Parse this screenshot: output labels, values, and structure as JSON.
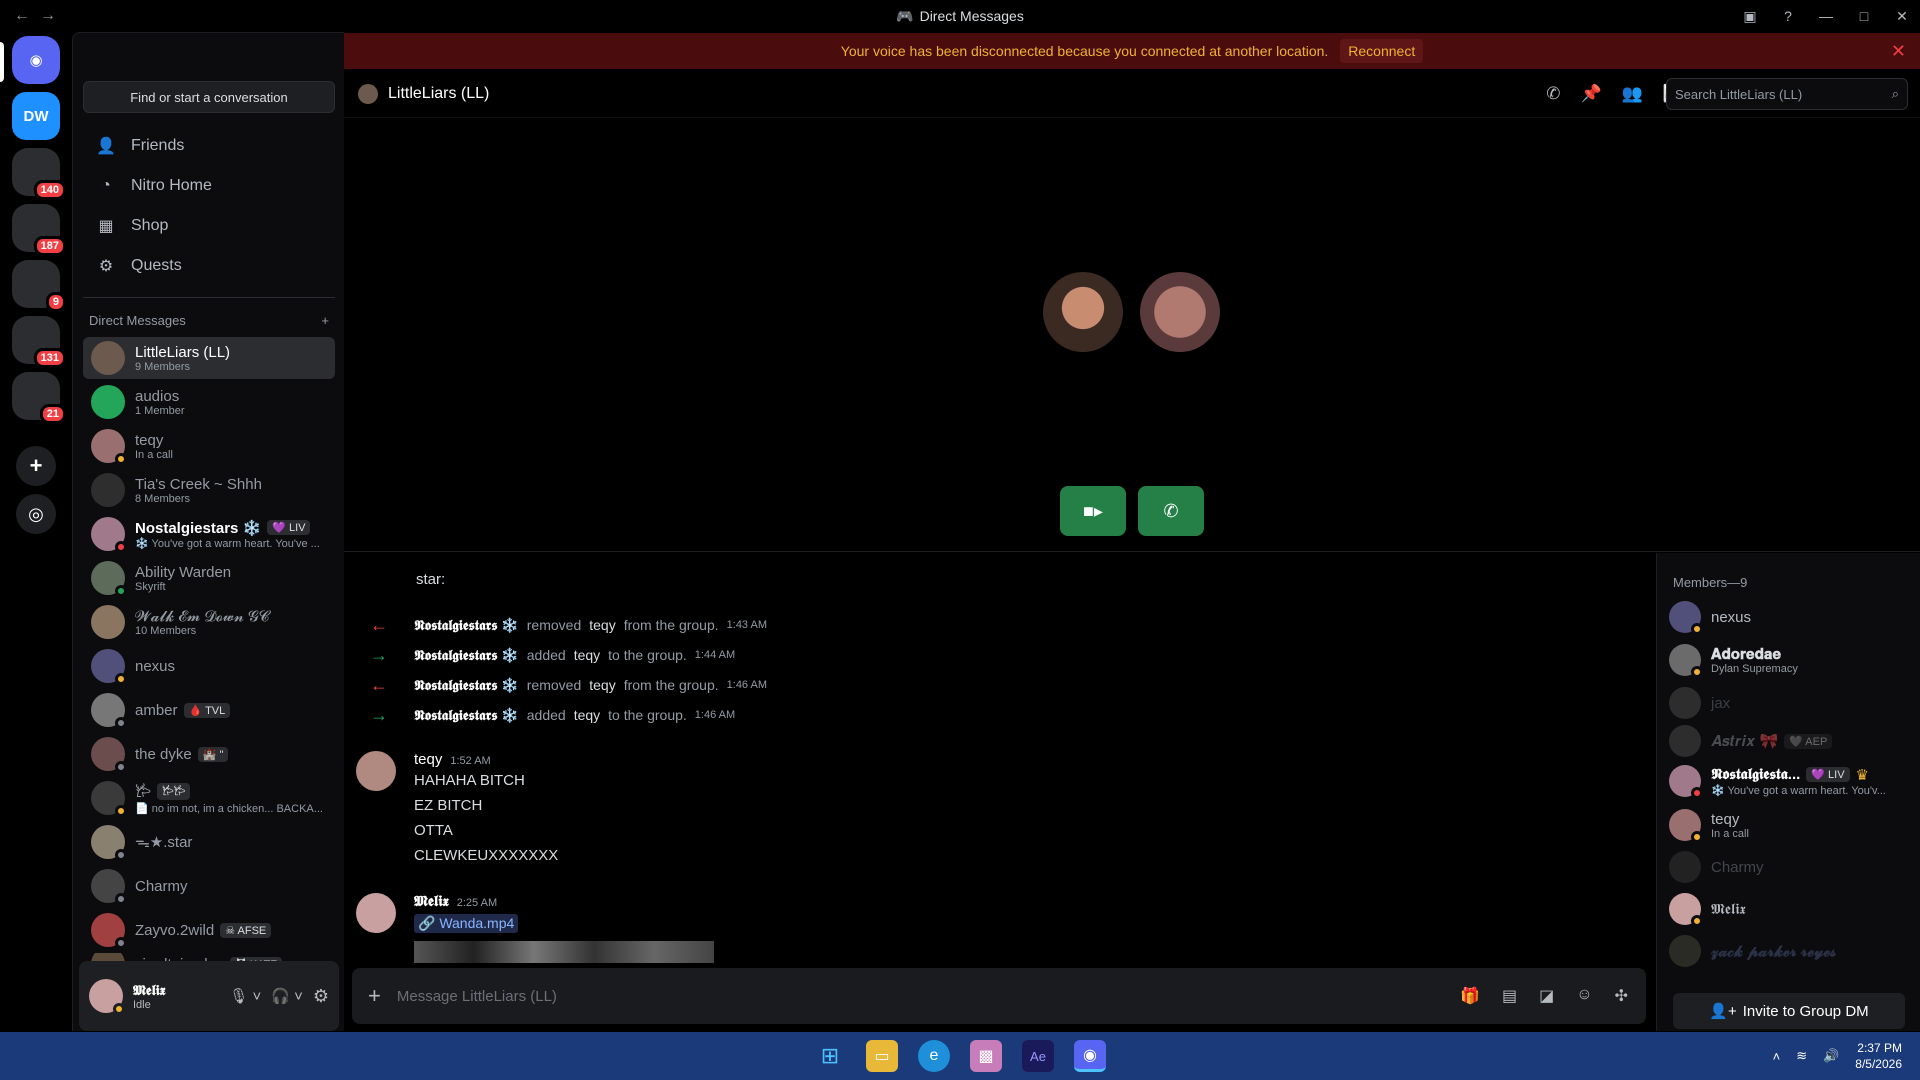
{
  "window": {
    "title": "Direct Messages",
    "back": "←",
    "forward": "→"
  },
  "banner": {
    "text": "Your voice has been disconnected because you connected at another location.",
    "reconnect": "Reconnect"
  },
  "servers": {
    "badges": [
      "140",
      "187",
      "9",
      "131",
      "21"
    ]
  },
  "sidebar": {
    "search_label": "Find or start a conversation",
    "nav": [
      "Friends",
      "Nitro Home",
      "Shop",
      "Quests"
    ],
    "dm_header": "Direct Messages",
    "dms": [
      {
        "name": "LittleLiars (LL)",
        "sub": "9 Members"
      },
      {
        "name": "audios",
        "sub": "1 Member"
      },
      {
        "name": "teqy",
        "sub": "In a call"
      },
      {
        "name": "Tia's Creek ~ Shhh",
        "sub": "8 Members"
      },
      {
        "name": "Nostalgiestars ❄️",
        "tag": "💜 LIV",
        "sub": "❄️ You've got a warm heart. You've ..."
      },
      {
        "name": "Ability Warden",
        "sub": "Skyrift"
      },
      {
        "name": "𝓦𝓪𝓵𝓴 𝓔𝓶 𝓓𝓸𝔀𝓷 𝓖𝓒",
        "sub": "10 Members"
      },
      {
        "name": "nexus",
        "sub": ""
      },
      {
        "name": "amber",
        "tag": "🩸 TVL",
        "sub": ""
      },
      {
        "name": "the dyke",
        "tag": "🏰 \"",
        "sub": ""
      },
      {
        "name": "𐂂",
        "tag": "𐂂𐂂",
        "sub": "📄 no im not, im a chicken... BACKA..."
      },
      {
        "name": "ᯓ★.star",
        "sub": ""
      },
      {
        "name": "Charmy",
        "sub": ""
      },
      {
        "name": "Zayvo.2wild",
        "tag": "☠ AFSE",
        "sub": ""
      },
      {
        "name": "siredtojayden",
        "tag": "😈 KATZ",
        "sub": ""
      }
    ]
  },
  "user": {
    "name": "𝕸𝖊𝖑𝖎𝖝",
    "status": "Idle"
  },
  "chat": {
    "name": "LittleLiars (LL)",
    "search_placeholder": "Search LittleLiars (LL)",
    "composer_placeholder": "Message LittleLiars (LL)",
    "messages_top": "star:",
    "system": [
      {
        "actor": "𝕹𝖔𝖘𝖙𝖆𝖑𝖌𝖎𝖊𝖘𝖙𝖆𝖗𝖘 ❄️",
        "action": "removed",
        "target": "teqy",
        "suffix": "from the group.",
        "time": "1:43 AM",
        "kind": "remove"
      },
      {
        "actor": "𝕹𝖔𝖘𝖙𝖆𝖑𝖌𝖎𝖊𝖘𝖙𝖆𝖗𝖘 ❄️",
        "action": "added",
        "target": "teqy",
        "suffix": "to the group.",
        "time": "1:44 AM",
        "kind": "add"
      },
      {
        "actor": "𝕹𝖔𝖘𝖙𝖆𝖑𝖌𝖎𝖊𝖘𝖙𝖆𝖗𝖘 ❄️",
        "action": "removed",
        "target": "teqy",
        "suffix": "from the group.",
        "time": "1:46 AM",
        "kind": "remove"
      },
      {
        "actor": "𝕹𝖔𝖘𝖙𝖆𝖑𝖌𝖎𝖊𝖘𝖙𝖆𝖗𝖘 ❄️",
        "action": "added",
        "target": "teqy",
        "suffix": "to the group.",
        "time": "1:46 AM",
        "kind": "add"
      }
    ],
    "msg1": {
      "author": "teqy",
      "time": "1:52 AM",
      "lines": [
        "HAHAHA BITCH",
        "EZ BITCH",
        "OTTA",
        "CLEWKEUXXXXXXX"
      ]
    },
    "msg2": {
      "author": "𝕸𝖊𝖑𝖎𝖝",
      "time": "2:25 AM",
      "attachment": "Wanda.mp4"
    }
  },
  "members": {
    "header": "Members—9",
    "list": [
      {
        "name": "nexus",
        "sub": ""
      },
      {
        "name": "𝐀𝐝𝐨𝐫𝐞𝐝𝐚𝐞",
        "sub": "Dylan Supremacy"
      },
      {
        "name": "jax",
        "sub": ""
      },
      {
        "name": "𝑨𝒔𝒕𝒓𝒊𝒙 🎀",
        "tag": "🩶 AEP",
        "sub": ""
      },
      {
        "name": "𝕹𝖔𝖘𝖙𝖆𝖑𝖌𝖎𝖊𝖘𝖙𝖆...",
        "tag": "💜 LIV",
        "sub": "❄️ You've got a warm heart. You'v..."
      },
      {
        "name": "teqy",
        "sub": "In a call"
      },
      {
        "name": "Charmy",
        "sub": ""
      },
      {
        "name": "𝕸𝖊𝖑𝖎𝖝",
        "sub": ""
      },
      {
        "name": "𝔃𝓪𝓬𝓴 𝓹𝓪𝓻𝓴𝓮𝓻 𝓻𝓮𝔂𝓮𝓼",
        "sub": ""
      }
    ],
    "invite": "Invite to Group DM"
  },
  "taskbar": {
    "time": "2:37 PM",
    "date": "8/5/2026"
  }
}
